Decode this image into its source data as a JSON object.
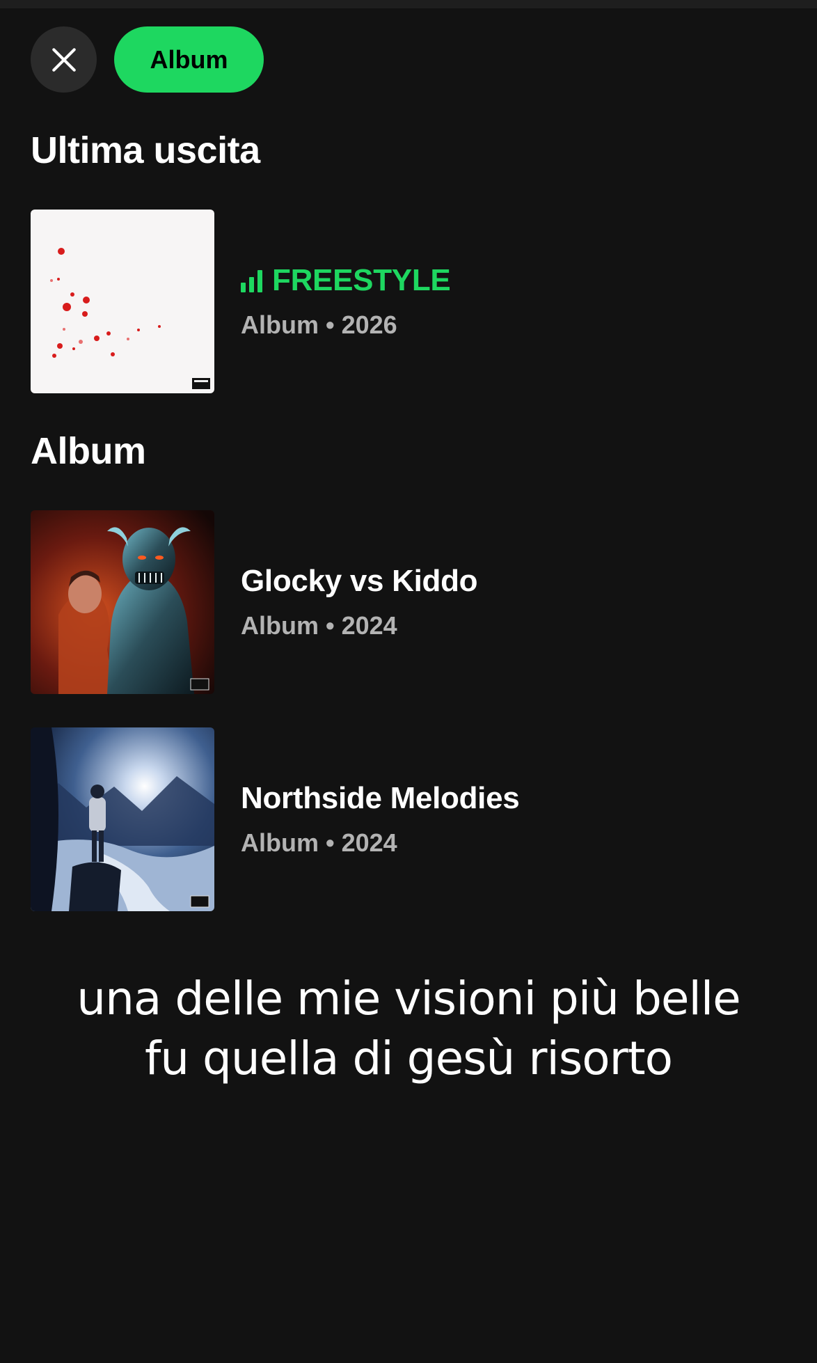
{
  "header": {
    "filter_chip_label": "Album"
  },
  "sections": {
    "latest_title": "Ultima uscita",
    "albums_title": "Album"
  },
  "latest_release": {
    "title": "FREESTYLE",
    "subtitle": "Album • 2026",
    "now_playing": true
  },
  "albums": [
    {
      "title": "Glocky vs Kiddo",
      "subtitle": "Album • 2024"
    },
    {
      "title": "Northside Melodies",
      "subtitle": "Album • 2024"
    }
  ],
  "caption": {
    "line1": "una delle mie visioni più belle",
    "line2": "fu quella di gesù risorto"
  },
  "colors": {
    "background": "#121212",
    "accent": "#1ed760",
    "secondary_text": "#b3b3b3"
  },
  "icons": {
    "close": "close-icon",
    "now_playing": "equalizer-icon"
  }
}
